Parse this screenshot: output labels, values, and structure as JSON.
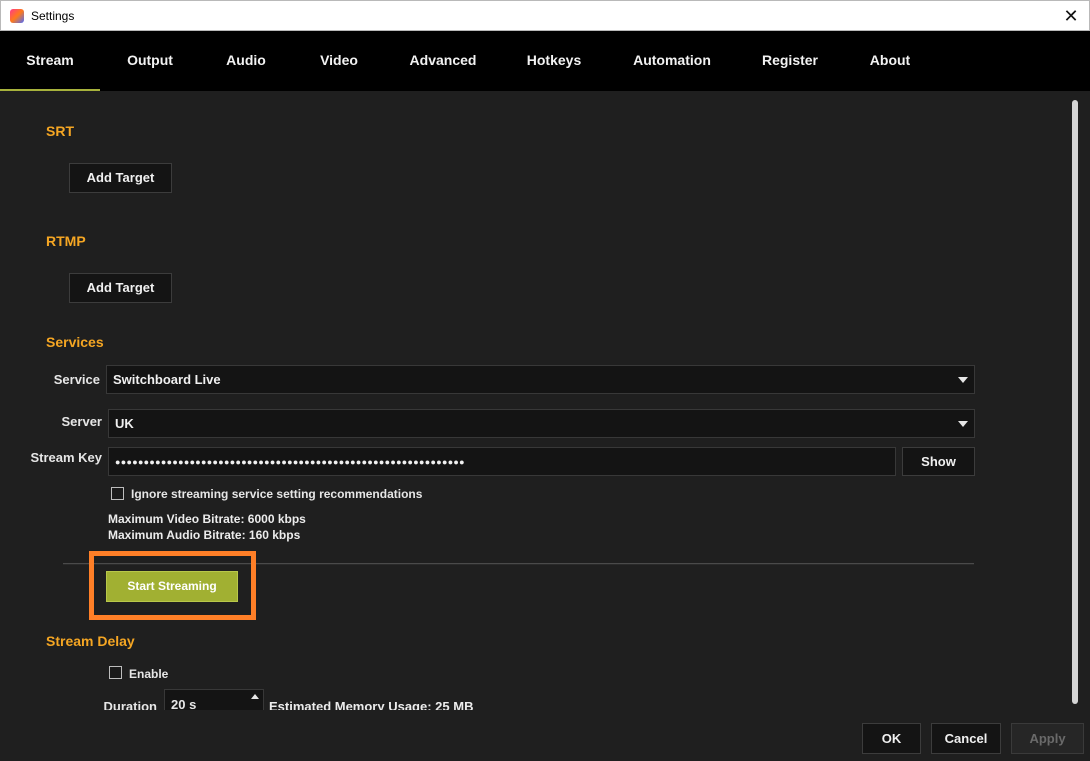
{
  "window": {
    "title": "Settings",
    "close_glyph": "✕"
  },
  "tabs": [
    {
      "label": "Stream"
    },
    {
      "label": "Output"
    },
    {
      "label": "Audio"
    },
    {
      "label": "Video"
    },
    {
      "label": "Advanced"
    },
    {
      "label": "Hotkeys"
    },
    {
      "label": "Automation"
    },
    {
      "label": "Register"
    },
    {
      "label": "About"
    }
  ],
  "active_tab": "Stream",
  "srt": {
    "title": "SRT",
    "add_target_label": "Add Target"
  },
  "rtmp": {
    "title": "RTMP",
    "add_target_label": "Add Target"
  },
  "services": {
    "title": "Services",
    "service_label": "Service",
    "service_value": "Switchboard Live",
    "server_label": "Server",
    "server_value": "UK",
    "stream_key_label": "Stream Key",
    "stream_key_value": "●●●●●●●●●●●●●●●●●●●●●●●●●●●●●●●●●●●●●●●●●●●●●●●●●●●●●●●●●●●●●",
    "show_label": "Show",
    "ignore_recommendations_label": "Ignore streaming service setting recommendations",
    "ignore_recommendations_checked": false,
    "max_video_bitrate": "Maximum Video Bitrate: 6000 kbps",
    "max_audio_bitrate": "Maximum Audio Bitrate: 160 kbps"
  },
  "start_streaming_label": "Start Streaming",
  "stream_delay": {
    "title": "Stream Delay",
    "enable_label": "Enable",
    "enable_checked": false,
    "duration_label": "Duration",
    "duration_value": "20 s",
    "memory_usage": "Estimated Memory Usage: 25 MB"
  },
  "footer": {
    "ok_label": "OK",
    "cancel_label": "Cancel",
    "apply_label": "Apply"
  },
  "colors": {
    "accent": "#a7b23c",
    "section_title": "#f5a623",
    "highlight": "#ff7f27",
    "start_button": "#a1b032"
  }
}
